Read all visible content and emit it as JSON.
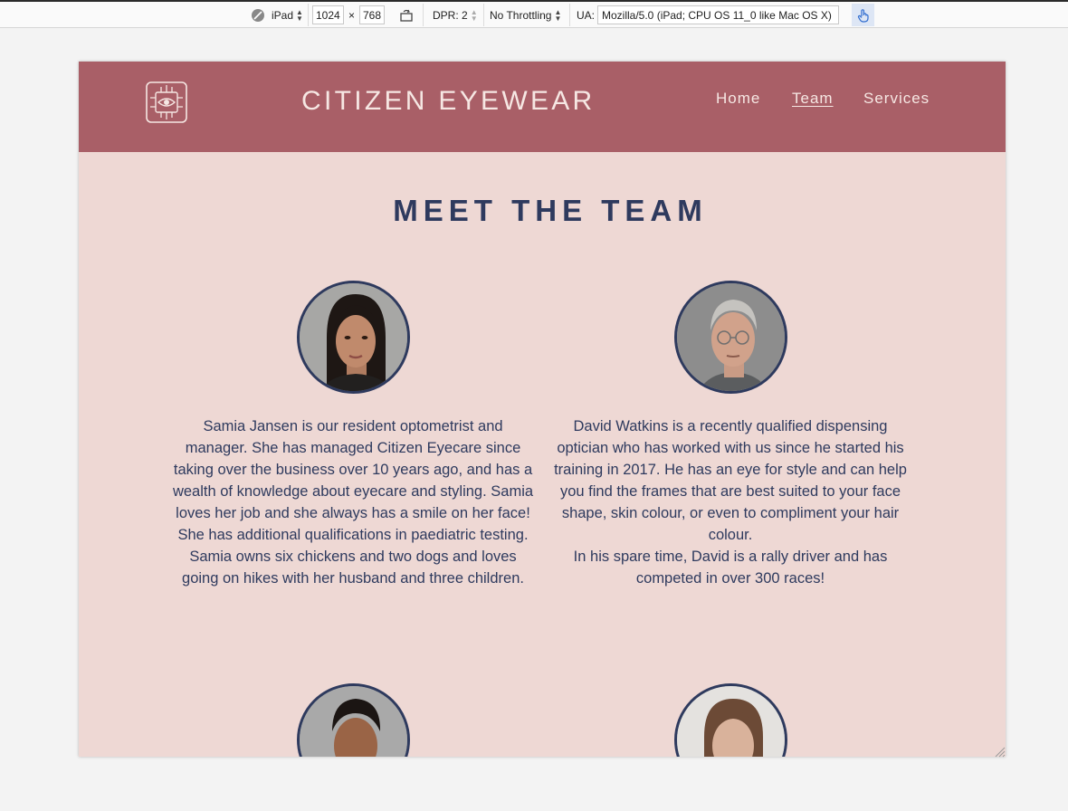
{
  "devtools": {
    "device": "iPad",
    "width": "1024",
    "times": "×",
    "height": "768",
    "dpr": "DPR: 2",
    "throttling": "No Throttling",
    "ua_label": "UA:",
    "ua_value": "Mozilla/5.0 (iPad; CPU OS 11_0 like Mac OS X)"
  },
  "site": {
    "brand": "CITIZEN EYEWEAR",
    "nav": [
      {
        "label": "Home",
        "active": false
      },
      {
        "label": "Team",
        "active": true
      },
      {
        "label": "Services",
        "active": false
      }
    ]
  },
  "team": {
    "title": "MEET THE TEAM",
    "members": [
      {
        "bio": "Samia Jansen is our resident optometrist and manager. She has managed Citizen Eyecare since taking over the business over 10 years ago, and has a wealth of knowledge about eyecare and styling. Samia loves her job and she always has a smile on her face! She has additional qualifications in paediatric testing.",
        "extra": "Samia owns six chickens and two dogs and loves going on hikes with her husband and three children."
      },
      {
        "bio": "David Watkins is a recently qualified dispensing optician who has worked with us since he started his training in 2017. He has an eye for style and can help you find the frames that are best suited to your face shape, skin colour, or even to compliment your hair colour.",
        "extra": "In his spare time, David is a rally driver and has competed in over 300 races!"
      }
    ]
  },
  "colors": {
    "header_bg": "#a95f67",
    "page_bg": "#eed8d4",
    "navy": "#2e3a5e",
    "header_text": "#f6e7e3"
  }
}
